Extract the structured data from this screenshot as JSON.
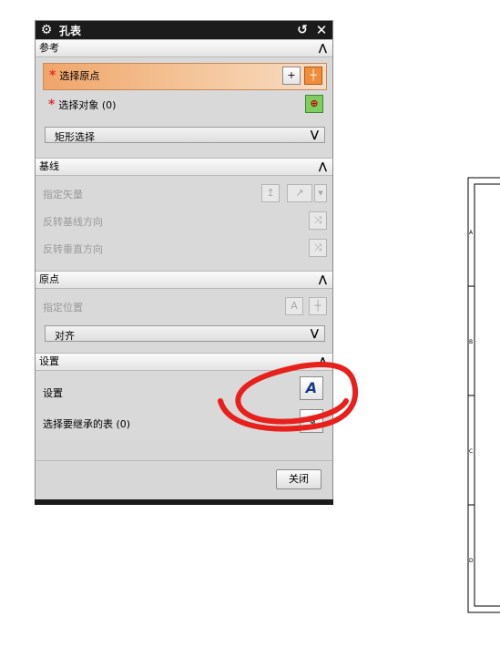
{
  "dialog": {
    "title": "孔表",
    "icons": {
      "settings": "gear-icon",
      "reset": "reset-icon",
      "close": "close-icon"
    }
  },
  "sections": {
    "reference": {
      "title": "参考",
      "select_origin": "选择原点",
      "select_objects": "选择对象 (0)",
      "selection_mode": "矩形选择"
    },
    "baseline": {
      "title": "基线",
      "specify_vector": "指定矢量",
      "reverse_baseline": "反转基线方向",
      "reverse_perpendicular": "反转垂直方向"
    },
    "origin": {
      "title": "原点",
      "specify_location": "指定位置",
      "alignment": "对齐"
    },
    "settings": {
      "title": "设置",
      "settings_label": "设置",
      "inherit_label": "选择要继承的表 (0)"
    }
  },
  "footer": {
    "close_label": "关闭"
  },
  "sheet": {
    "zone_labels": [
      "A",
      "B",
      "C",
      "D"
    ]
  },
  "colors": {
    "annotation_red": "#e8201c",
    "selected_row": "#f0a56a"
  }
}
